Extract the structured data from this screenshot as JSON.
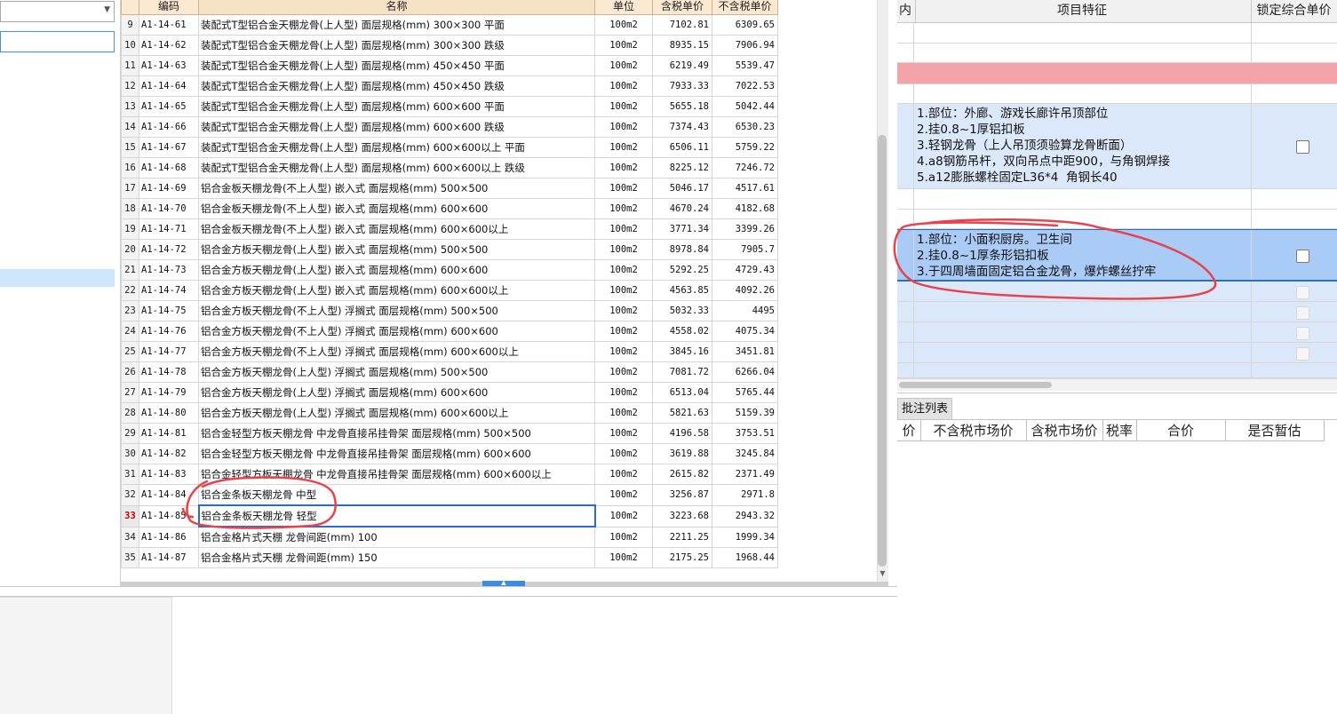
{
  "quota_table": {
    "headers": {
      "code": "编码",
      "name": "名称",
      "unit": "单位",
      "price_tax": "含税单价",
      "price_notax": "不含税单价"
    },
    "active_row": "33",
    "rows": [
      {
        "idx": "9",
        "code": "A1-14-61",
        "name": "装配式T型铝合金天棚龙骨(上人型) 面层规格(mm) 300×300 平面",
        "unit": "100m2",
        "price_tax": "7102.81",
        "price_notax": "6309.65"
      },
      {
        "idx": "10",
        "code": "A1-14-62",
        "name": "装配式T型铝合金天棚龙骨(上人型) 面层规格(mm) 300×300 跌级",
        "unit": "100m2",
        "price_tax": "8935.15",
        "price_notax": "7906.94"
      },
      {
        "idx": "11",
        "code": "A1-14-63",
        "name": "装配式T型铝合金天棚龙骨(上人型) 面层规格(mm) 450×450 平面",
        "unit": "100m2",
        "price_tax": "6219.49",
        "price_notax": "5539.47"
      },
      {
        "idx": "12",
        "code": "A1-14-64",
        "name": "装配式T型铝合金天棚龙骨(上人型) 面层规格(mm) 450×450 跌级",
        "unit": "100m2",
        "price_tax": "7933.33",
        "price_notax": "7022.53"
      },
      {
        "idx": "13",
        "code": "A1-14-65",
        "name": "装配式T型铝合金天棚龙骨(上人型) 面层规格(mm) 600×600 平面",
        "unit": "100m2",
        "price_tax": "5655.18",
        "price_notax": "5042.44"
      },
      {
        "idx": "14",
        "code": "A1-14-66",
        "name": "装配式T型铝合金天棚龙骨(上人型) 面层规格(mm) 600×600 跌级",
        "unit": "100m2",
        "price_tax": "7374.43",
        "price_notax": "6530.23"
      },
      {
        "idx": "15",
        "code": "A1-14-67",
        "name": "装配式T型铝合金天棚龙骨(上人型) 面层规格(mm) 600×600以上 平面",
        "unit": "100m2",
        "price_tax": "6506.11",
        "price_notax": "5759.22"
      },
      {
        "idx": "16",
        "code": "A1-14-68",
        "name": "装配式T型铝合金天棚龙骨(上人型) 面层规格(mm) 600×600以上 跌级",
        "unit": "100m2",
        "price_tax": "8225.12",
        "price_notax": "7246.72"
      },
      {
        "idx": "17",
        "code": "A1-14-69",
        "name": "铝合金板天棚龙骨(不上人型) 嵌入式 面层规格(mm) 500×500",
        "unit": "100m2",
        "price_tax": "5046.17",
        "price_notax": "4517.61"
      },
      {
        "idx": "18",
        "code": "A1-14-70",
        "name": "铝合金板天棚龙骨(不上人型) 嵌入式 面层规格(mm) 600×600",
        "unit": "100m2",
        "price_tax": "4670.24",
        "price_notax": "4182.68"
      },
      {
        "idx": "19",
        "code": "A1-14-71",
        "name": "铝合金板天棚龙骨(不上人型) 嵌入式 面层规格(mm) 600×600以上",
        "unit": "100m2",
        "price_tax": "3771.34",
        "price_notax": "3399.26"
      },
      {
        "idx": "20",
        "code": "A1-14-72",
        "name": "铝合金方板天棚龙骨(上人型) 嵌入式 面层规格(mm) 500×500",
        "unit": "100m2",
        "price_tax": "8978.84",
        "price_notax": "7905.7"
      },
      {
        "idx": "21",
        "code": "A1-14-73",
        "name": "铝合金方板天棚龙骨(上人型) 嵌入式 面层规格(mm) 600×600",
        "unit": "100m2",
        "price_tax": "5292.25",
        "price_notax": "4729.43"
      },
      {
        "idx": "22",
        "code": "A1-14-74",
        "name": "铝合金方板天棚龙骨(上人型) 嵌入式 面层规格(mm) 600×600以上",
        "unit": "100m2",
        "price_tax": "4563.85",
        "price_notax": "4092.26"
      },
      {
        "idx": "23",
        "code": "A1-14-75",
        "name": "铝合金方板天棚龙骨(不上人型) 浮搁式 面层规格(mm) 500×500",
        "unit": "100m2",
        "price_tax": "5032.33",
        "price_notax": "4495"
      },
      {
        "idx": "24",
        "code": "A1-14-76",
        "name": "铝合金方板天棚龙骨(不上人型) 浮搁式 面层规格(mm) 600×600",
        "unit": "100m2",
        "price_tax": "4558.02",
        "price_notax": "4075.34"
      },
      {
        "idx": "25",
        "code": "A1-14-77",
        "name": "铝合金方板天棚龙骨(不上人型) 浮搁式 面层规格(mm) 600×600以上",
        "unit": "100m2",
        "price_tax": "3845.16",
        "price_notax": "3451.81"
      },
      {
        "idx": "26",
        "code": "A1-14-78",
        "name": "铝合金方板天棚龙骨(上人型) 浮搁式 面层规格(mm) 500×500",
        "unit": "100m2",
        "price_tax": "7081.72",
        "price_notax": "6266.04"
      },
      {
        "idx": "27",
        "code": "A1-14-79",
        "name": "铝合金方板天棚龙骨(上人型) 浮搁式 面层规格(mm) 600×600",
        "unit": "100m2",
        "price_tax": "6513.04",
        "price_notax": "5765.44"
      },
      {
        "idx": "28",
        "code": "A1-14-80",
        "name": "铝合金方板天棚龙骨(上人型) 浮搁式 面层规格(mm) 600×600以上",
        "unit": "100m2",
        "price_tax": "5821.63",
        "price_notax": "5159.39"
      },
      {
        "idx": "29",
        "code": "A1-14-81",
        "name": "铝合金轻型方板天棚龙骨 中龙骨直接吊挂骨架 面层规格(mm) 500×500",
        "unit": "100m2",
        "price_tax": "4196.58",
        "price_notax": "3753.51"
      },
      {
        "idx": "30",
        "code": "A1-14-82",
        "name": "铝合金轻型方板天棚龙骨 中龙骨直接吊挂骨架 面层规格(mm) 600×600",
        "unit": "100m2",
        "price_tax": "3619.88",
        "price_notax": "3245.84"
      },
      {
        "idx": "31",
        "code": "A1-14-83",
        "name": "铝合金轻型方板天棚龙骨 中龙骨直接吊挂骨架 面层规格(mm) 600×600以上",
        "unit": "100m2",
        "price_tax": "2615.82",
        "price_notax": "2371.49"
      },
      {
        "idx": "32",
        "code": "A1-14-84",
        "name": "铝合金条板天棚龙骨 中型",
        "unit": "100m2",
        "price_tax": "3256.87",
        "price_notax": "2971.8"
      },
      {
        "idx": "33",
        "code": "A1-14-85",
        "name": "铝合金条板天棚龙骨 轻型",
        "unit": "100m2",
        "price_tax": "3223.68",
        "price_notax": "2943.32"
      },
      {
        "idx": "34",
        "code": "A1-14-86",
        "name": "铝合金格片式天棚 龙骨间距(mm) 100",
        "unit": "100m2",
        "price_tax": "2211.25",
        "price_notax": "1999.34"
      },
      {
        "idx": "35",
        "code": "A1-14-87",
        "name": "铝合金格片式天棚 龙骨间距(mm) 150",
        "unit": "100m2",
        "price_tax": "2175.25",
        "price_notax": "1968.44"
      }
    ]
  },
  "right_panel": {
    "header_partial": "内",
    "header_feature": "项目特征",
    "header_lock": "锁定综合单价",
    "feature_block_1": "1.部位：外廊、游戏长廊许吊顶部位\n2.挂0.8~1厚铝扣板\n3.轻钢龙骨（上人吊顶须验算龙骨断面）\n4.a8钢筋吊杆，双向吊点中距900，与角钢焊接\n5.a12膨胀螺栓固定L36*4  角钢长40",
    "feature_block_2": "1.部位：小面积厨房。卫生间\n2.挂0.8~1厚条形铝扣板\n3.于四周墙面固定铝合金龙骨，爆炸螺丝拧牢",
    "tab_annotations": "批注列表",
    "lower_headers": [
      "价",
      "不含税市场价",
      "含税市场价",
      "税率",
      "合价",
      "是否暂估"
    ]
  },
  "colors": {
    "header_bg": "#fbe8d0",
    "selection_blue": "#2b6cc4",
    "pink_row": "#f4a4a8",
    "light_blue_row": "#dbe8f9",
    "selected_blue_row": "#a9cbf5",
    "annotation_red": "#e8434c"
  }
}
